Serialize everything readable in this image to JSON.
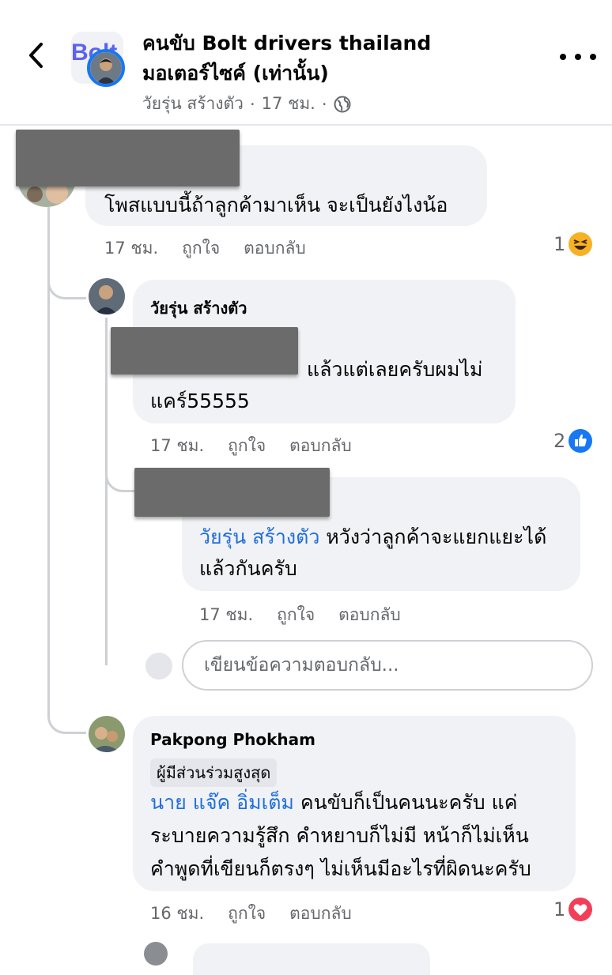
{
  "header": {
    "group_name_line1": "คนขับ Bolt drivers thailand",
    "group_name_line2": "มอเตอร์ไซค์ (เท่านั้น)",
    "group_logo_text": "Bolt",
    "author": "วัยรุ่น สร้างตัว",
    "time": "17 ชม.",
    "separator": "·",
    "privacy_icon": "globe-icon"
  },
  "comments": [
    {
      "text": "โพสแบบนี้ถ้าลูกค้ามาเห็น จะเป็นยังไงน้อ",
      "time": "17 ชม.",
      "like": "ถูกใจ",
      "reply": "ตอบกลับ",
      "reaction_count": "1",
      "reaction": "haha",
      "reaction_color": "#f7b125"
    },
    {
      "name": "วัยรุ่น สร้างตัว",
      "text_line1": "แล้วแต่เลยครับผมไม่",
      "text_line2": "แคร์55555",
      "time": "17 ชม.",
      "like": "ถูกใจ",
      "reply": "ตอบกลับ",
      "reaction_count": "2",
      "reaction": "like",
      "reaction_color": "#1877f2"
    },
    {
      "mention": "วัยรุ่น สร้างตัว",
      "text_line1": " หวังว่าลูกค้าจะแยกแยะได้",
      "text_line2": "แล้วกันครับ",
      "time": "17 ชม.",
      "like": "ถูกใจ",
      "reply": "ตอบกลับ"
    },
    {
      "name": "Pakpong Phokham",
      "badge": "ผู้มีส่วนร่วมสูงสุด",
      "mention": "นาย แจ๊ค อิ่มเต็ม",
      "text_line1": " คนขับก็เป็นคนนะครับ แค่",
      "text_line2": "ระบายความรู้สึก คำหยาบก็ไม่มี หน้าก็ไม่เห็น",
      "text_line3": "คำพูดที่เขียนก็ตรงๆ ไม่เห็นมีอะไรที่ผิดนะครับ",
      "time": "16 ชม.",
      "like": "ถูกใจ",
      "reply": "ตอบกลับ",
      "reaction_count": "1",
      "reaction": "love",
      "reaction_color": "#f33e58"
    }
  ],
  "reply_input": {
    "placeholder": "เขียนข้อความตอบกลับ..."
  },
  "colors": {
    "link": "#216fdb",
    "bubble": "#f0f2f5",
    "meta": "#65676b",
    "accent": "#1877f2"
  }
}
